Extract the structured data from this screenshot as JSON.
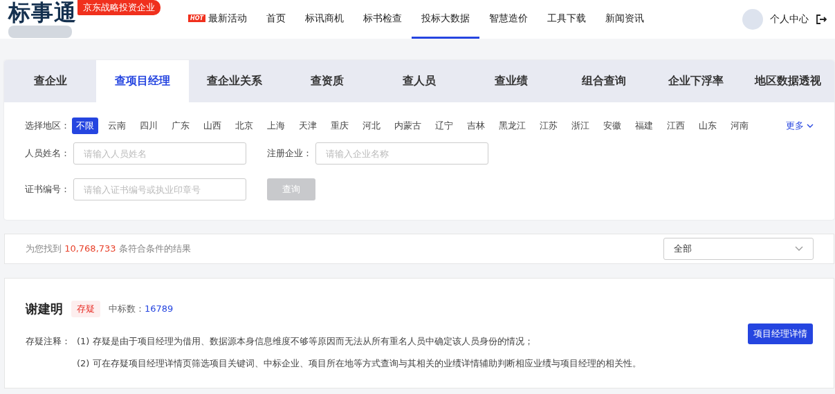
{
  "header": {
    "logo": "标事通",
    "badge": "京东战略投资企业",
    "nav": [
      {
        "label": "最新活动",
        "badge": "HOT",
        "selected": false
      },
      {
        "label": "首页",
        "selected": false
      },
      {
        "label": "标讯商机",
        "selected": false
      },
      {
        "label": "标书检查",
        "selected": false
      },
      {
        "label": "投标大数据",
        "selected": true
      },
      {
        "label": "智慧造价",
        "selected": false
      },
      {
        "label": "工具下载",
        "selected": false
      },
      {
        "label": "新闻资讯",
        "selected": false
      }
    ],
    "user": "个人中心"
  },
  "tabs": [
    {
      "label": "查企业",
      "selected": false
    },
    {
      "label": "查项目经理",
      "selected": true
    },
    {
      "label": "查企业关系",
      "selected": false
    },
    {
      "label": "查资质",
      "selected": false
    },
    {
      "label": "查人员",
      "selected": false
    },
    {
      "label": "查业绩",
      "selected": false
    },
    {
      "label": "组合查询",
      "selected": false
    },
    {
      "label": "企业下浮率",
      "selected": false
    },
    {
      "label": "地区数据透视",
      "selected": false
    }
  ],
  "filters": {
    "region_label": "选择地区：",
    "regions": [
      {
        "label": "不限",
        "selected": true
      },
      {
        "label": "云南",
        "selected": false
      },
      {
        "label": "四川",
        "selected": false
      },
      {
        "label": "广东",
        "selected": false
      },
      {
        "label": "山西",
        "selected": false
      },
      {
        "label": "北京",
        "selected": false
      },
      {
        "label": "上海",
        "selected": false
      },
      {
        "label": "天津",
        "selected": false
      },
      {
        "label": "重庆",
        "selected": false
      },
      {
        "label": "河北",
        "selected": false
      },
      {
        "label": "内蒙古",
        "selected": false
      },
      {
        "label": "辽宁",
        "selected": false
      },
      {
        "label": "吉林",
        "selected": false
      },
      {
        "label": "黑龙江",
        "selected": false
      },
      {
        "label": "江苏",
        "selected": false
      },
      {
        "label": "浙江",
        "selected": false
      },
      {
        "label": "安徽",
        "selected": false
      },
      {
        "label": "福建",
        "selected": false
      },
      {
        "label": "江西",
        "selected": false
      },
      {
        "label": "山东",
        "selected": false
      },
      {
        "label": "河南",
        "selected": false
      }
    ],
    "more": "更多",
    "fields": [
      {
        "label": "人员姓名：",
        "placeholder": "请输入人员姓名"
      },
      {
        "label": "注册企业：",
        "placeholder": "请输入企业名称"
      },
      {
        "label": "证书编号：",
        "placeholder": "请输入证书编号或执业印章号"
      }
    ],
    "search_button": {
      "label": "查询",
      "disabled": true
    }
  },
  "results": {
    "prefix": "为您找到",
    "count": "10,768,733",
    "suffix": "条符合条件的结果",
    "sort": "全部"
  },
  "person": {
    "name": "谢建明",
    "tag": "存疑",
    "stat_label": "中标数：",
    "stat_value": "16789",
    "button": "项目经理详情",
    "note_label": "存疑注释：",
    "notes": [
      "(1) 存疑是由于项目经理为借用、数据源本身信息维度不够等原因而无法从所有重名人员中确定该人员身份的情况；",
      "(2) 可在存疑项目经理详情页筛选项目关键词、中标企业、项目所在地等方式查询与其相关的业绩详情辅助判断相应业绩与项目经理的相关性。"
    ]
  }
}
